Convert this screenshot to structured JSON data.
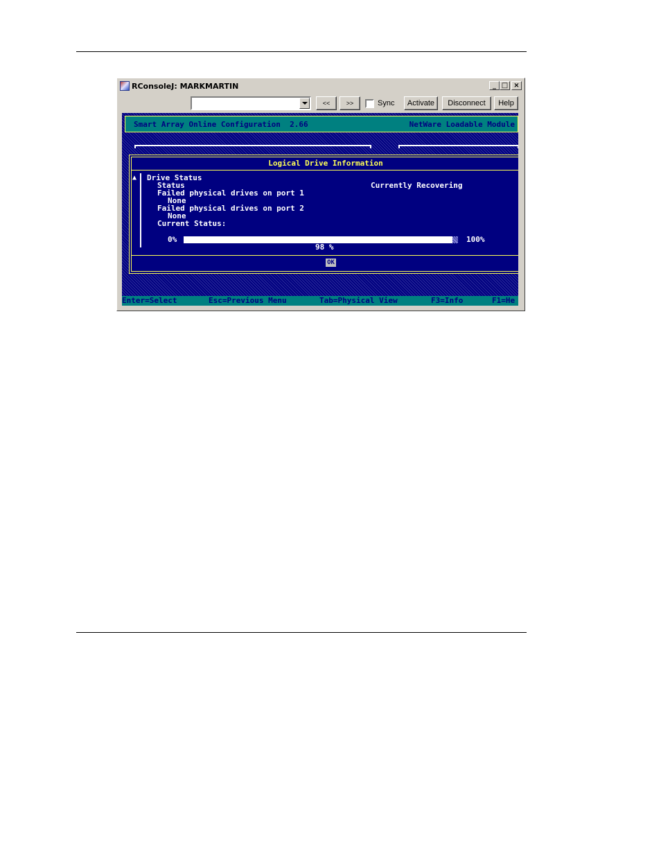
{
  "window": {
    "title": "RConsoleJ: MARKMARTIN",
    "controls": {
      "minimize": "_",
      "maximize": "□",
      "close": "×"
    }
  },
  "toolbar": {
    "server_combo_value": "",
    "prev_label": "<<",
    "next_label": ">>",
    "sync_label": "Sync",
    "sync_checked": false,
    "activate_label": "Activate",
    "disconnect_label": "Disconnect",
    "help_label": "Help"
  },
  "console": {
    "banner_left": "Smart Array Online Configuration  2.66",
    "banner_right": "NetWare Loadable Module",
    "dialog": {
      "title": "Logical Drive Information",
      "scroll_indicator": "▲",
      "lines": {
        "drive_status": "Drive Status",
        "status_label": "Status",
        "status_value": "Currently Recovering",
        "failed_port1_label": "Failed physical drives on port 1",
        "failed_port1_value": "None",
        "failed_port2_label": "Failed physical drives on port 2",
        "failed_port2_value": "None",
        "current_status_label": "Current Status:"
      },
      "progress": {
        "min_label": "0%",
        "max_label": "100%",
        "value_label": "98 %",
        "fraction": 0.98
      },
      "ok_label": "OK"
    },
    "statusbar": {
      "keys": [
        "Enter=Select",
        "Esc=Previous Menu",
        "Tab=Physical View",
        "F3=Info",
        "F1=He"
      ]
    }
  },
  "colors": {
    "console_background": "#000080",
    "banner": "#008080",
    "highlight_text": "#ffff55",
    "window_chrome": "#d4d0c8"
  }
}
